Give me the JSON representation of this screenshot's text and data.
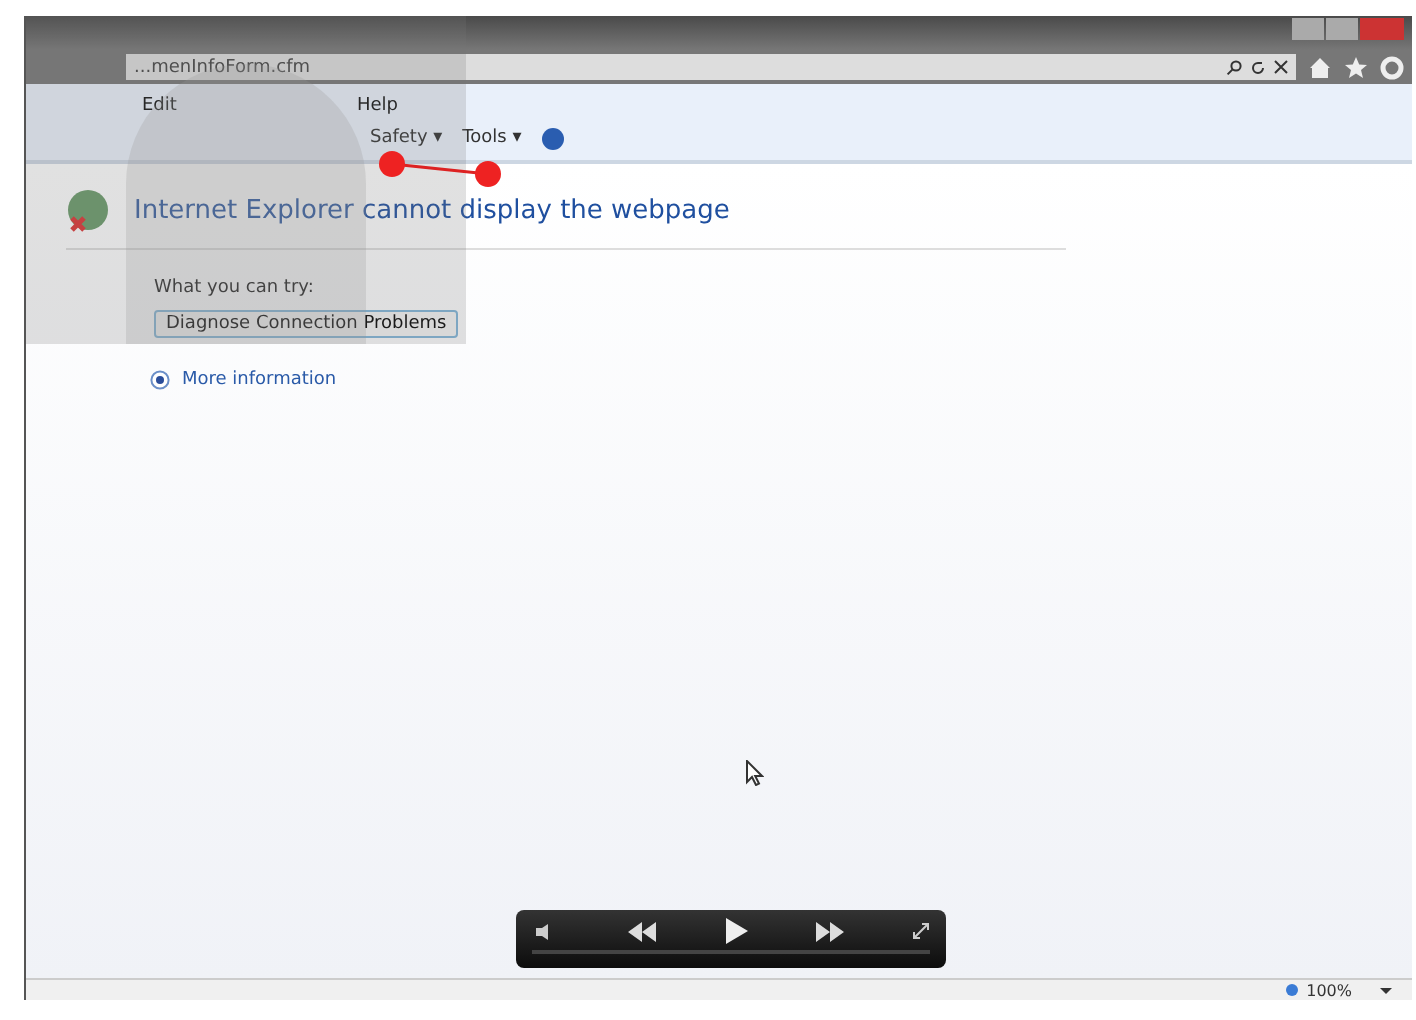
{
  "browser": {
    "address": "...menInfoForm.cfm",
    "menu": [
      "Edit",
      "Help"
    ],
    "commands": [
      "Safety ▾",
      "Tools ▾"
    ]
  },
  "page": {
    "heading": "Internet Explorer cannot display the webpage",
    "tip": "What you can try:",
    "button": "Diagnose Connection Problems",
    "link": "More information"
  },
  "status_bar": {
    "zoom": "100%"
  }
}
